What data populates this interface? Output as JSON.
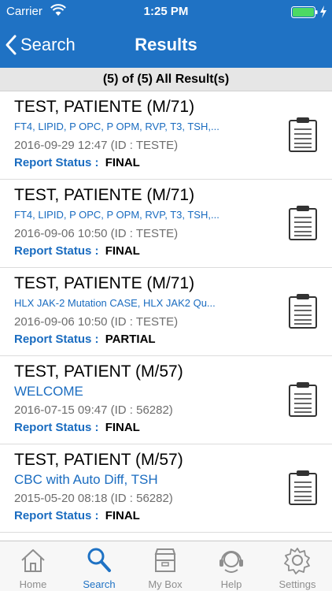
{
  "status_bar": {
    "carrier": "Carrier",
    "time": "1:25 PM",
    "battery_color": "#4cd964"
  },
  "nav": {
    "back_label": "Search",
    "title": "Results"
  },
  "summary": "(5) of (5) All Result(s)",
  "status_label": "Report Status :",
  "results": [
    {
      "name": "TEST, PATIENTE  (M/71)",
      "tests": "FT4, LIPID, P OPC, P OPM, RVP, T3, TSH,...",
      "date_id": "2016-09-29 12:47 (ID : TESTE)",
      "status": "FINAL"
    },
    {
      "name": "TEST, PATIENTE  (M/71)",
      "tests": "FT4, LIPID, P OPC, P OPM, RVP, T3, TSH,...",
      "date_id": "2016-09-06 10:50 (ID : TESTE)",
      "status": "FINAL"
    },
    {
      "name": "TEST, PATIENTE  (M/71)",
      "tests": "HLX JAK-2 Mutation CASE, HLX JAK2 Qu...",
      "date_id": "2016-09-06 10:50 (ID : TESTE)",
      "status": "PARTIAL"
    },
    {
      "name": "TEST, PATIENT  (M/57)",
      "tests": "WELCOME",
      "date_id": "2016-07-15 09:47 (ID : 56282)",
      "status": "FINAL"
    },
    {
      "name": "TEST, PATIENT  (M/57)",
      "tests": "CBC with Auto Diff, TSH",
      "date_id": "2015-05-20 08:18 (ID : 56282)",
      "status": "FINAL"
    }
  ],
  "tabs": [
    {
      "label": "Home",
      "icon": "home-icon",
      "active": false
    },
    {
      "label": "Search",
      "icon": "search-icon",
      "active": true
    },
    {
      "label": "My Box",
      "icon": "box-icon",
      "active": false
    },
    {
      "label": "Help",
      "icon": "help-icon",
      "active": false
    },
    {
      "label": "Settings",
      "icon": "gear-icon",
      "active": false
    }
  ],
  "colors": {
    "primary": "#1f72c4",
    "link": "#1a6cc0",
    "tab_inactive": "#8e8e8e"
  }
}
